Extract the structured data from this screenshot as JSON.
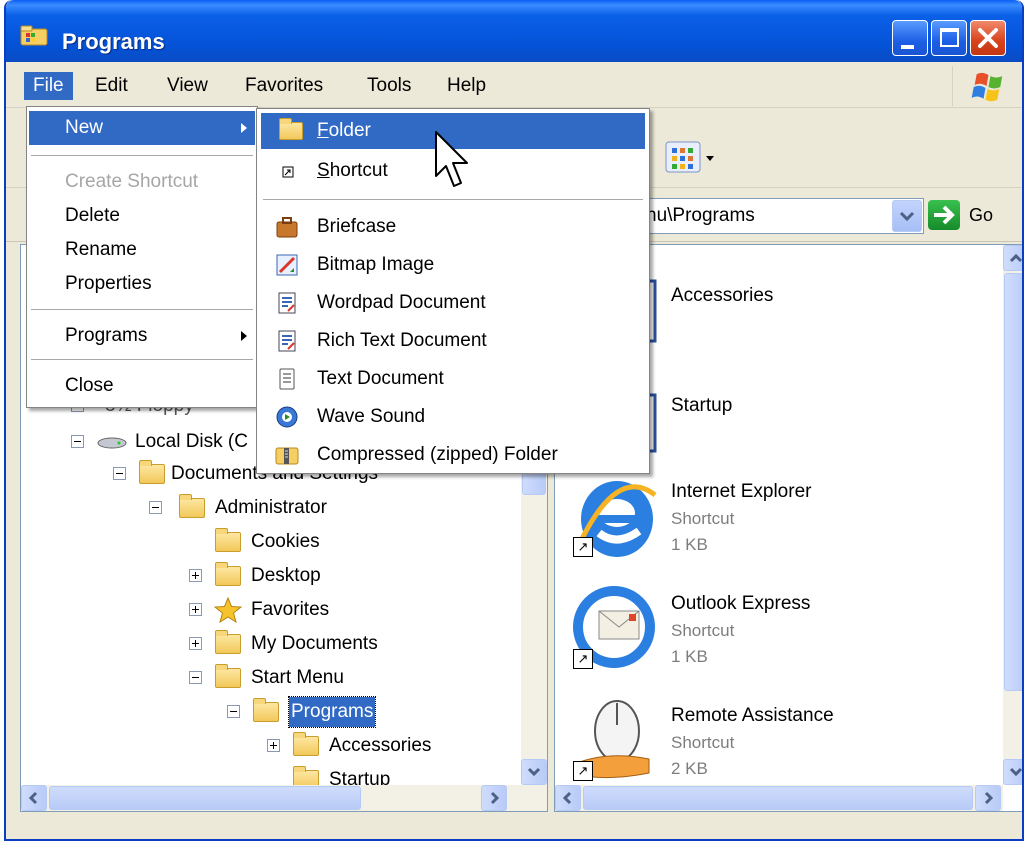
{
  "window": {
    "title": "Programs"
  },
  "menubar": {
    "items": [
      "File",
      "Edit",
      "View",
      "Favorites",
      "Tools",
      "Help"
    ],
    "active": "File"
  },
  "address": {
    "value": "nu\\Programs",
    "go_label": "Go"
  },
  "file_menu": {
    "new": "New",
    "create_shortcut": "Create Shortcut",
    "delete": "Delete",
    "rename": "Rename",
    "properties": "Properties",
    "programs": "Programs",
    "close": "Close"
  },
  "new_submenu": {
    "folder_first": "F",
    "folder_rest": "older",
    "shortcut_first": "S",
    "shortcut_rest": "hortcut",
    "briefcase": "Briefcase",
    "bitmap": "Bitmap Image",
    "wordpad": "Wordpad Document",
    "rtf": "Rich Text Document",
    "text": "Text Document",
    "wave": "Wave Sound",
    "zip": "Compressed (zipped) Folder"
  },
  "tree": {
    "floppy": "3½ Floppy",
    "local_disk": "Local Disk (C",
    "docs_settings": "Documents and Settings",
    "administrator": "Administrator",
    "cookies": "Cookies",
    "desktop": "Desktop",
    "favorites": "Favorites",
    "my_documents": "My Documents",
    "start_menu": "Start Menu",
    "programs": "Programs",
    "accessories": "Accessories",
    "startup": "Startup"
  },
  "files": {
    "accessories": "Accessories",
    "startup": "Startup",
    "ie": {
      "name": "Internet Explorer",
      "type": "Shortcut",
      "size": "1 KB"
    },
    "oe": {
      "name": "Outlook Express",
      "type": "Shortcut",
      "size": "1 KB"
    },
    "ra": {
      "name": "Remote Assistance",
      "type": "Shortcut",
      "size": "2 KB"
    }
  },
  "colors": {
    "titlebar": "#0454d6",
    "highlight": "#316ac5",
    "close_button": "#d8421a",
    "face": "#ece9d8"
  }
}
